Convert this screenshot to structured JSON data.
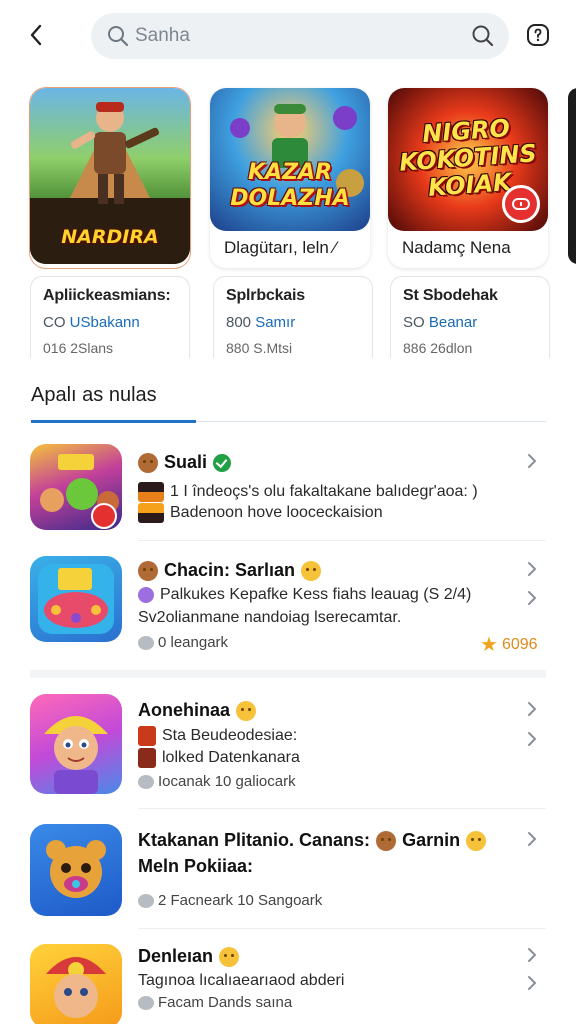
{
  "header": {
    "back_icon": "chevron-left-icon",
    "search_placeholder": "Sanha",
    "search_icon": "search-icon",
    "help_icon": "help-icon"
  },
  "featured": [
    {
      "art_title": "NARDIRA",
      "caption": ""
    },
    {
      "art_title": "KAZAR DOLAZHA",
      "caption": "Dlagütarı, leln ⁄"
    },
    {
      "art_title": "NIGRO KOKOTINS KOIAK",
      "caption": "Nadamç Nena"
    }
  ],
  "info_cards": [
    {
      "title": "Apliickeasmians:",
      "line2_prefix": "CO",
      "line2_link": "USbakann",
      "line3": "016 2Slans"
    },
    {
      "title": "Splrbckais",
      "line2_prefix": "800",
      "line2_link": "Samır",
      "line3": "880 S.Mtsi"
    },
    {
      "title": "St Sbodehak",
      "line2_prefix": "SO",
      "line2_link": "Beanar",
      "line3": "886 26dlon"
    }
  ],
  "section": {
    "title": "Apalı as nulas"
  },
  "list": [
    {
      "title": "Suali",
      "line1": "1 I îndeoçs's olu fakaltakane balıdegr'aoa: )",
      "line2": "Badenoon hove looceckaision",
      "meta": "",
      "rating": ""
    },
    {
      "title": "Chacin: Sarlıan",
      "line1": "Palkukes Kepafke Kess fiahs leauag (S 2/4)",
      "line2": "Sv2olianmane nandoiag lserecamtar.",
      "meta": "0 leangark",
      "rating": "6096"
    },
    {
      "title": "Aonehinaa",
      "line1": "Sta Beudeodesiae:",
      "line2": "lolked Datenkanara",
      "meta": "Iocanak 10 galiocark",
      "rating": ""
    },
    {
      "title": "Ktakanan Plitanio. Canans:",
      "title_extra": "Garnin",
      "title_line2": "Meln Pokiiaa:",
      "meta": "2 Facneark 10 Sangoark",
      "rating": ""
    },
    {
      "title": "Denleıan",
      "line1": "Tagınoa lıcalıaearıaod abderi",
      "line2": "Facam Dands saına",
      "meta": "",
      "rating": ""
    }
  ],
  "colors": {
    "accent": "#1e73c8",
    "rating": "#e08a1c",
    "search_bg": "#eef1f4"
  }
}
